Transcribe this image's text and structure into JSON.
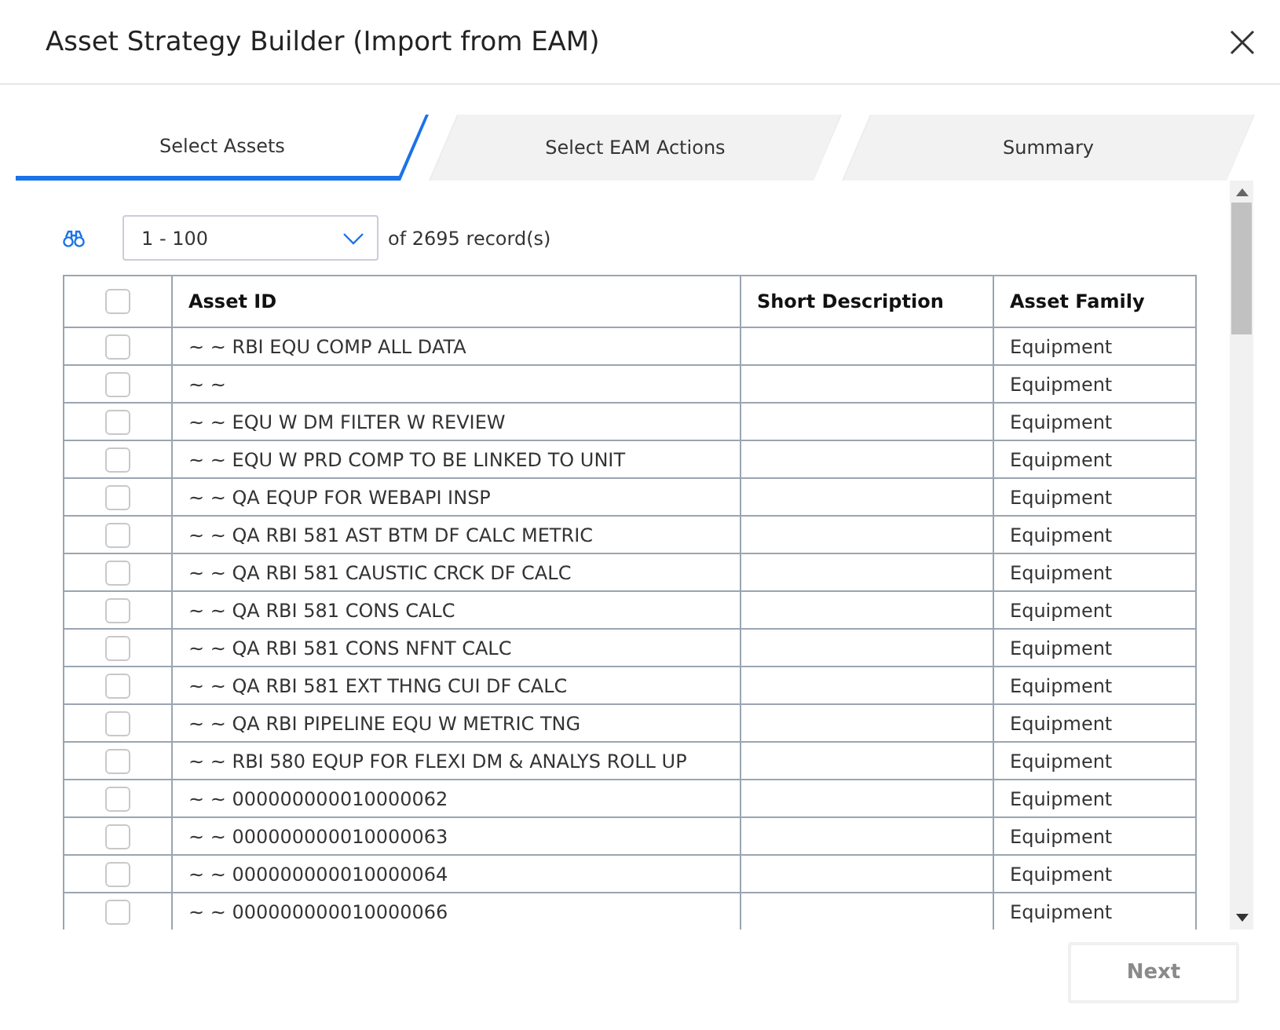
{
  "window": {
    "title": "Asset Strategy Builder (Import from EAM)"
  },
  "tabs": [
    {
      "label": "Select Assets",
      "selected": true
    },
    {
      "label": "Select EAM Actions",
      "selected": false
    },
    {
      "label": "Summary",
      "selected": false
    }
  ],
  "pager": {
    "range": "1 - 100",
    "of": "of",
    "total": "2695",
    "unit": "record(s)"
  },
  "table": {
    "select_all": {
      "checked": false
    },
    "columns": [
      "Asset ID",
      "Short Description",
      "Asset Family"
    ],
    "rows": [
      {
        "checked": false,
        "cells": [
          "~ ~ RBI EQU COMP ALL DATA",
          "",
          "Equipment"
        ]
      },
      {
        "checked": false,
        "cells": [
          "~ ~",
          "",
          "Equipment"
        ]
      },
      {
        "checked": false,
        "cells": [
          "~ ~ EQU W DM FILTER W REVIEW",
          "",
          "Equipment"
        ]
      },
      {
        "checked": false,
        "cells": [
          "~ ~ EQU W PRD COMP TO BE LINKED TO UNIT",
          "",
          "Equipment"
        ]
      },
      {
        "checked": false,
        "cells": [
          "~ ~ QA EQUP FOR WEBAPI INSP",
          "",
          "Equipment"
        ]
      },
      {
        "checked": false,
        "cells": [
          "~ ~ QA RBI 581 AST BTM DF CALC METRIC",
          "",
          "Equipment"
        ]
      },
      {
        "checked": false,
        "cells": [
          "~ ~ QA RBI 581 CAUSTIC CRCK DF CALC",
          "",
          "Equipment"
        ]
      },
      {
        "checked": false,
        "cells": [
          "~ ~ QA RBI 581 CONS CALC",
          "",
          "Equipment"
        ]
      },
      {
        "checked": false,
        "cells": [
          "~ ~ QA RBI 581 CONS NFNT CALC",
          "",
          "Equipment"
        ]
      },
      {
        "checked": false,
        "cells": [
          "~ ~ QA RBI 581 EXT THNG CUI DF CALC",
          "",
          "Equipment"
        ]
      },
      {
        "checked": false,
        "cells": [
          "~ ~ QA RBI PIPELINE EQU W METRIC TNG",
          "",
          "Equipment"
        ]
      },
      {
        "checked": false,
        "cells": [
          "~ ~ RBI 580 EQUP FOR FLEXI DM & ANALYS ROLL UP",
          "",
          "Equipment"
        ]
      },
      {
        "checked": false,
        "cells": [
          "~ ~ 000000000010000062",
          "",
          "Equipment"
        ]
      },
      {
        "checked": false,
        "cells": [
          "~ ~ 000000000010000063",
          "",
          "Equipment"
        ]
      },
      {
        "checked": false,
        "cells": [
          "~ ~ 000000000010000064",
          "",
          "Equipment"
        ]
      },
      {
        "checked": false,
        "cells": [
          "~ ~ 000000000010000066",
          "",
          "Equipment"
        ]
      }
    ]
  },
  "footer": {
    "next": {
      "label": "Next",
      "disabled": true
    }
  }
}
